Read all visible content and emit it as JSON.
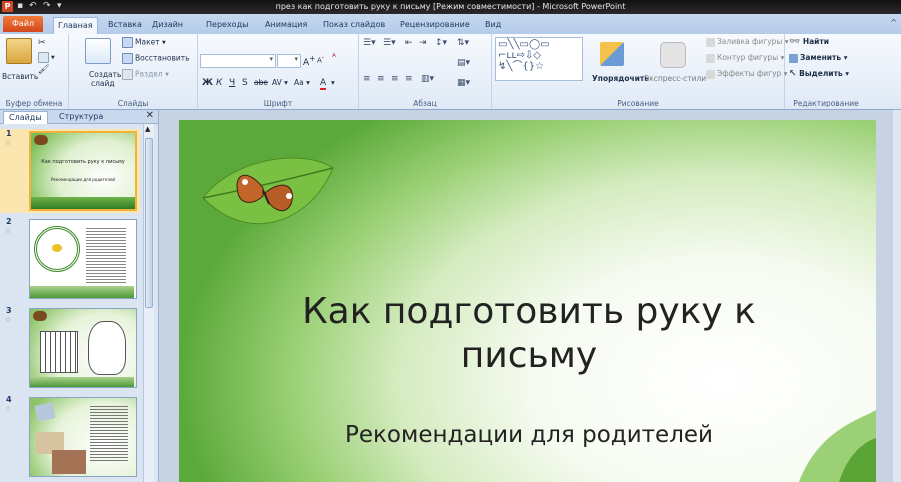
{
  "window": {
    "title": "през как подготовить руку к письму [Режим совместимости] - Microsoft PowerPoint",
    "app_icon": "P"
  },
  "quick_access": [
    "save-icon",
    "undo-icon",
    "redo-icon",
    "customize-icon"
  ],
  "tabs": [
    {
      "label": "Файл"
    },
    {
      "label": "Главная"
    },
    {
      "label": "Вставка"
    },
    {
      "label": "Дизайн"
    },
    {
      "label": "Переходы"
    },
    {
      "label": "Анимация"
    },
    {
      "label": "Показ слайдов"
    },
    {
      "label": "Рецензирование"
    },
    {
      "label": "Вид"
    }
  ],
  "ribbon": {
    "clipboard": {
      "paste": "Вставить",
      "group": "Буфер обмена"
    },
    "slides": {
      "create": "Создать",
      "create2": "слайд",
      "layout": "Макет",
      "reset": "Восстановить",
      "section": "Раздел",
      "group": "Слайды"
    },
    "font": {
      "group": "Шрифт",
      "bold": "Ж",
      "italic": "К",
      "underline": "Ч",
      "strike": "S",
      "abc": "abe",
      "av": "AV",
      "aa": "Aa",
      "a_up": "A",
      "a_down": "A",
      "color_a": "A"
    },
    "paragraph": {
      "group": "Абзац"
    },
    "drawing": {
      "arrange": "Упорядочить",
      "quick_styles": "Экспресс-стили",
      "fill": "Заливка фигуры",
      "outline": "Контур фигуры",
      "effects": "Эффекты фигур",
      "group": "Рисование"
    },
    "editing": {
      "find": "Найти",
      "replace": "Заменить",
      "select": "Выделить",
      "group": "Редактирование"
    }
  },
  "pane": {
    "tab_slides": "Слайды",
    "tab_outline": "Структура",
    "close": "✕",
    "thumbs": [
      {
        "num": "1",
        "star": "☆",
        "title": "Как подготовить руку к письму",
        "subtitle": "Рекомендации для родителей"
      },
      {
        "num": "2",
        "star": "☆"
      },
      {
        "num": "3",
        "star": "☆"
      },
      {
        "num": "4",
        "star": "☆"
      }
    ]
  },
  "slide": {
    "title": "Как подготовить руку к письму",
    "subtitle": "Рекомендации для родителей"
  },
  "colors": {
    "file_tab": "#d2471c",
    "green_dark": "#5ba93a",
    "green_light": "#d4ebbf",
    "selection": "#f1b13a"
  }
}
